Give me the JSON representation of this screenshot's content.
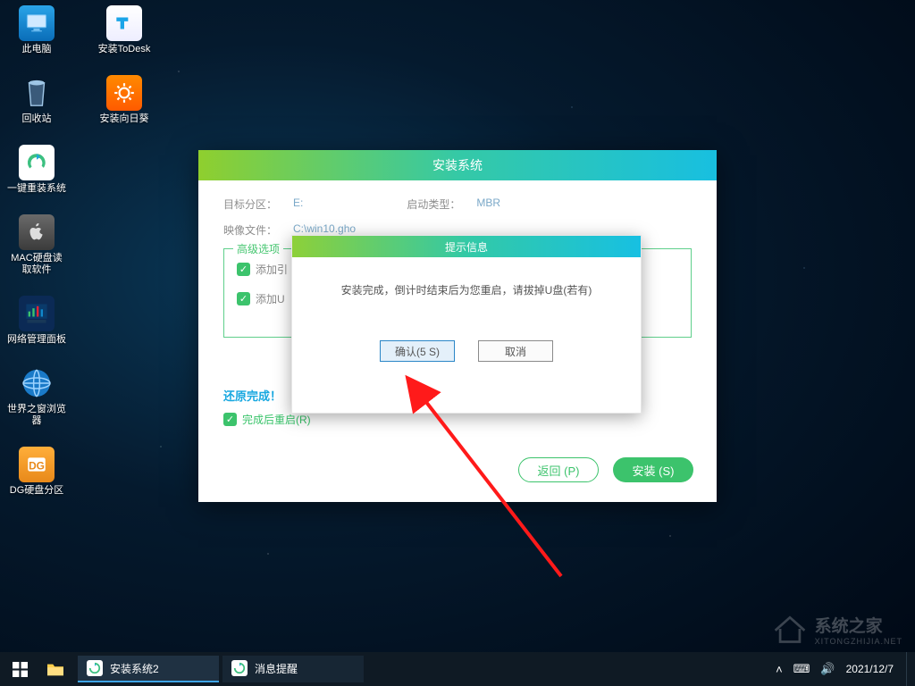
{
  "desktop": {
    "row1": [
      {
        "label": "此电脑"
      },
      {
        "label": "安装ToDesk"
      }
    ],
    "row2": [
      {
        "label": "回收站"
      },
      {
        "label": "安装向日葵"
      }
    ],
    "single": [
      {
        "label": "一键重装系统"
      },
      {
        "label": "MAC硬盘读\n取软件"
      },
      {
        "label": "网络管理面板"
      },
      {
        "label": "世界之窗浏览\n器"
      },
      {
        "label": "DG硬盘分区"
      }
    ]
  },
  "installer": {
    "title": "安装系统",
    "target_partition_label": "目标分区：",
    "target_partition_value": "E:",
    "boot_type_label": "启动类型：",
    "boot_type_value": "MBR",
    "image_file_label": "映像文件：",
    "image_file_value": "C:\\win10.gho",
    "adv_legend": "高级选项",
    "chk1": "添加引",
    "chk2": "添加U",
    "restore_done": "还原完成！",
    "reboot_after_label": "完成后重启(R)",
    "back_btn": "返回 (P)",
    "install_btn": "安装 (S)"
  },
  "modal": {
    "title": "提示信息",
    "message": "安装完成，倒计时结束后为您重启，请拔掉U盘(若有)",
    "confirm": "确认(5 S)",
    "cancel": "取消"
  },
  "watermark": {
    "text": "系统之家",
    "sub": "XITONGZHIJIA.NET"
  },
  "taskbar": {
    "task1": "安装系统2",
    "task2": "消息提醒",
    "date": "2021/12/7"
  }
}
